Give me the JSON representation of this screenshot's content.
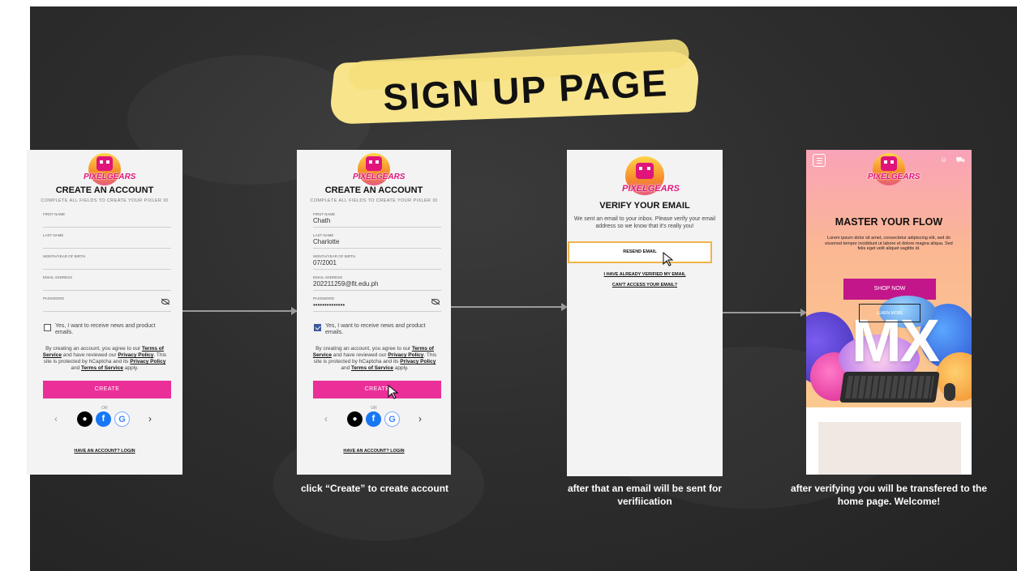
{
  "header": {
    "title": "SIGN UP PAGE"
  },
  "screen1": {
    "logo_text": "PIXELGEARS",
    "title": "CREATE AN ACCOUNT",
    "subtitle": "COMPLETE ALL FIELDS TO CREATE YOUR PIXLER ID",
    "fields": [
      {
        "label": "FIRST NAME",
        "value": ""
      },
      {
        "label": "LAST NAME",
        "value": ""
      },
      {
        "label": "MONTH/YEAR OF BIRTH",
        "value": ""
      },
      {
        "label": "EMAIL ADDRESS",
        "value": ""
      },
      {
        "label": "PASSWORD",
        "value": ""
      }
    ],
    "checkbox_label": "Yes, I want to receive news and product emails.",
    "checkbox_checked": false,
    "legal": {
      "t1": "By creating an account, you agree to our ",
      "terms": "Terms of Service",
      "t2": " and have reviewed our ",
      "privacy": "Privacy Policy",
      "t3": ". This site is protected by hCaptcha and its ",
      "privacy2": "Privacy Policy",
      "t4": " and ",
      "terms2": "Terms of Service",
      "t5": " apply."
    },
    "create_label": "CREATE",
    "or_label": "OR",
    "login_label": "HAVE AN ACCOUNT? LOGIN"
  },
  "screen2": {
    "logo_text": "PIXELGEARS",
    "title": "CREATE AN ACCOUNT",
    "subtitle": "COMPLETE ALL FIELDS TO CREATE YOUR PIXLER ID",
    "fields": [
      {
        "label": "FIRST NAME",
        "value": "Chath"
      },
      {
        "label": "LAST NAME",
        "value": "Charlotte"
      },
      {
        "label": "MONTH/YEAR OF BIRTH",
        "value": "07/2001"
      },
      {
        "label": "EMAIL ADDRESS",
        "value": "202211259@fit.edu.ph"
      },
      {
        "label": "PASSWORD",
        "value": "••••••••••••••"
      }
    ],
    "checkbox_label": "Yes, I want to receive news and product emails.",
    "checkbox_checked": true,
    "legal": {
      "t1": "By creating an account, you agree to our ",
      "terms": "Terms of Service",
      "t2": " and have reviewed our ",
      "privacy": "Privacy Policy",
      "t3": ". This site is protected by hCaptcha and its ",
      "privacy2": "Privacy Policy",
      "t4": " and ",
      "terms2": "Terms of Service",
      "t5": " apply."
    },
    "create_label": "CREATE",
    "or_label": "OR",
    "login_label": "HAVE AN ACCOUNT? LOGIN"
  },
  "screen3": {
    "logo_text": "PIXELGEARS",
    "title": "VERIFY YOUR EMAIL",
    "message": "We sent an email to your inbox. Please verify your email address so we know that it's really you!",
    "resend_label": "RESEND EMAIL",
    "verified_link": "I HAVE ALREADY VERIFIED MY EMAIL",
    "cant_access_link": "CAN'T ACCESS YOUR EMAIL?"
  },
  "screen4": {
    "logo_text": "PIXELGEARS",
    "headline": "MASTER YOUR FLOW",
    "body": "Lorem ipsum dolor sit amet, consectetur adipiscing elit, sed do eiusmod tempor incididunt ut labore et dolore magna aliqua. Sed felis eget velit aliquet sagittis id.",
    "shop_label": "SHOP NOW",
    "learn_label": "LEARN MORE",
    "hero_text": "MX"
  },
  "captions": {
    "c2": "click “Create” to create account",
    "c3": "after that an email will be sent for verifiication",
    "c4": "after verifying you will be transfered to the home page. Welcome!"
  },
  "colors": {
    "accent": "#ea2f99",
    "brand_magenta": "#c2168a",
    "highlight": "#f7e48b",
    "board": "#2e2e2e"
  }
}
